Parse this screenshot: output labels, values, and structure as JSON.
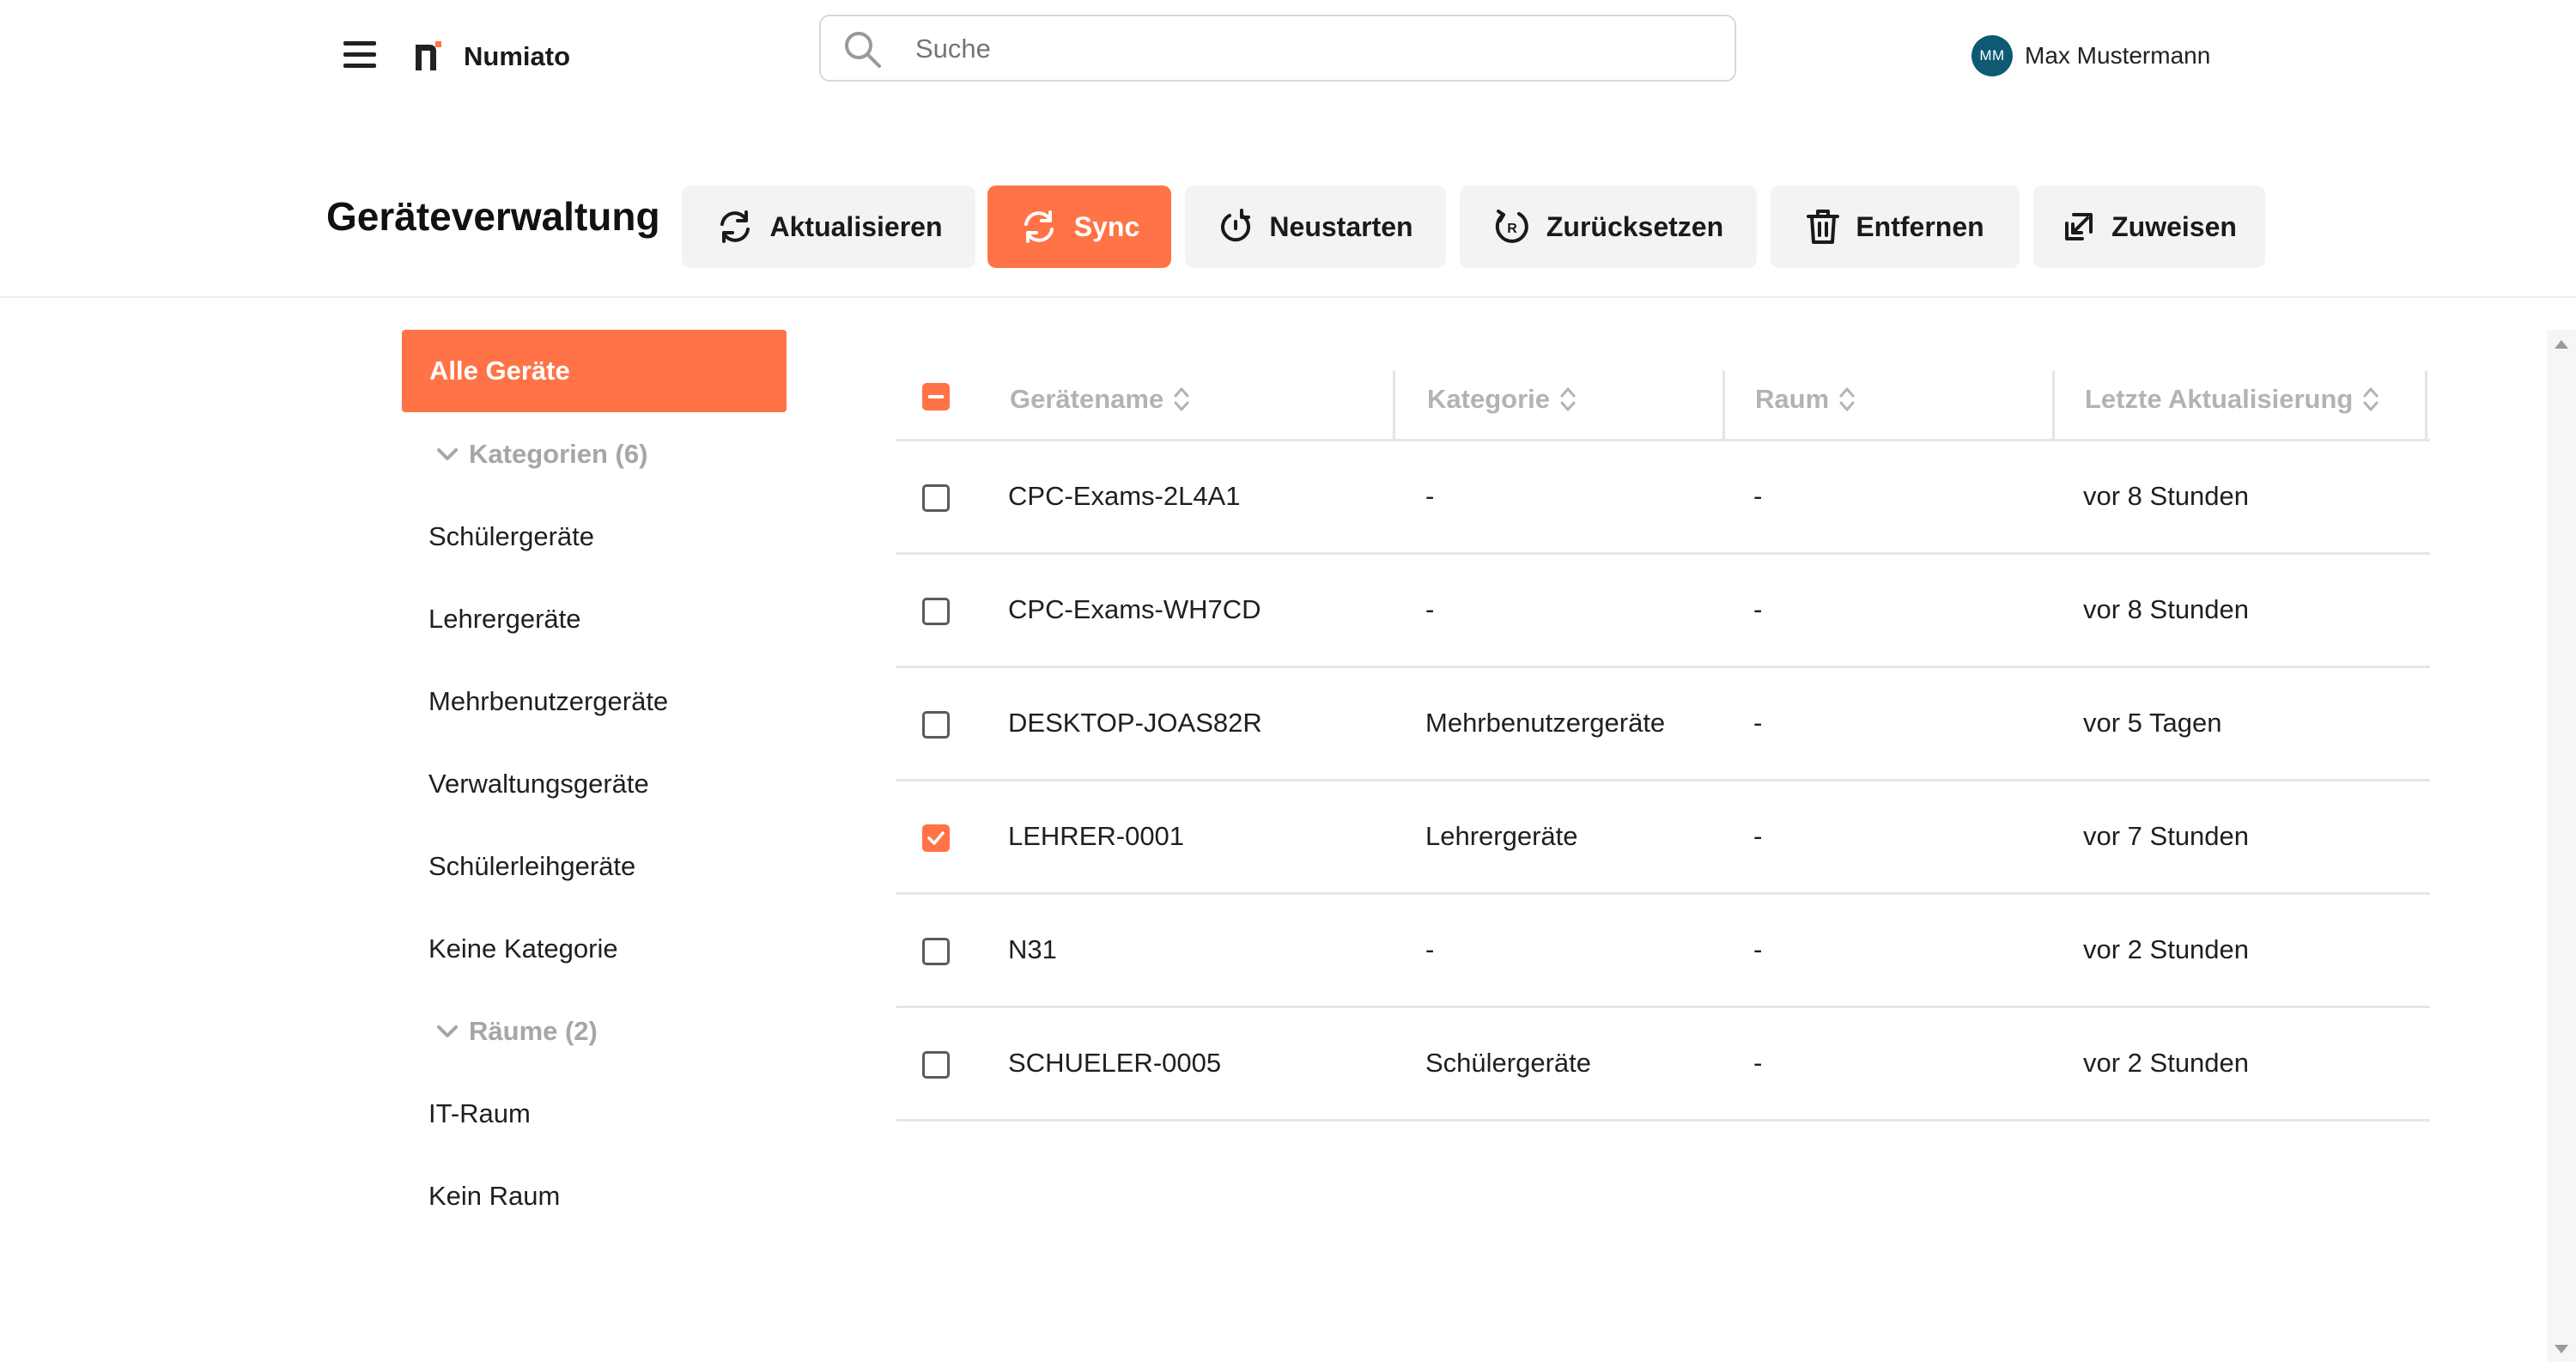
{
  "app": {
    "title": "Numiato"
  },
  "search": {
    "placeholder": "Suche"
  },
  "user": {
    "initials": "MM",
    "name": "Max Mustermann"
  },
  "page": {
    "title": "Geräteverwaltung"
  },
  "actions": {
    "refresh": "Aktualisieren",
    "sync": "Sync",
    "restart": "Neustarten",
    "reset": "Zurücksetzen",
    "remove": "Entfernen",
    "assign": "Zuweisen"
  },
  "sidebar": {
    "all_devices": "Alle Geräte",
    "categories_header": "Kategorien (6)",
    "categories": [
      "Schülergeräte",
      "Lehrergeräte",
      "Mehrbenutzergeräte",
      "Verwaltungsgeräte",
      "Schülerleihgeräte",
      "Keine Kategorie"
    ],
    "rooms_header": "Räume (2)",
    "rooms": [
      "IT-Raum",
      "Kein Raum"
    ]
  },
  "table": {
    "columns": [
      "Gerätename",
      "Kategorie",
      "Raum",
      "Letzte Aktualisierung"
    ],
    "rows": [
      {
        "name": "CPC-Exams-2L4A1",
        "category": "-",
        "room": "-",
        "updated": "vor 8 Stunden",
        "checked": false
      },
      {
        "name": "CPC-Exams-WH7CD",
        "category": "-",
        "room": "-",
        "updated": "vor 8 Stunden",
        "checked": false
      },
      {
        "name": "DESKTOP-JOAS82R",
        "category": "Mehrbenutzergeräte",
        "room": "-",
        "updated": "vor 5 Tagen",
        "checked": false
      },
      {
        "name": "LEHRER-0001",
        "category": "Lehrergeräte",
        "room": "-",
        "updated": "vor 7 Stunden",
        "checked": true
      },
      {
        "name": "N31",
        "category": "-",
        "room": "-",
        "updated": "vor 2 Stunden",
        "checked": false
      },
      {
        "name": "SCHUELER-0005",
        "category": "Schülergeräte",
        "room": "-",
        "updated": "vor 2 Stunden",
        "checked": false
      }
    ]
  },
  "colors": {
    "accent": "#ff7346",
    "avatar": "#0e5a73"
  }
}
